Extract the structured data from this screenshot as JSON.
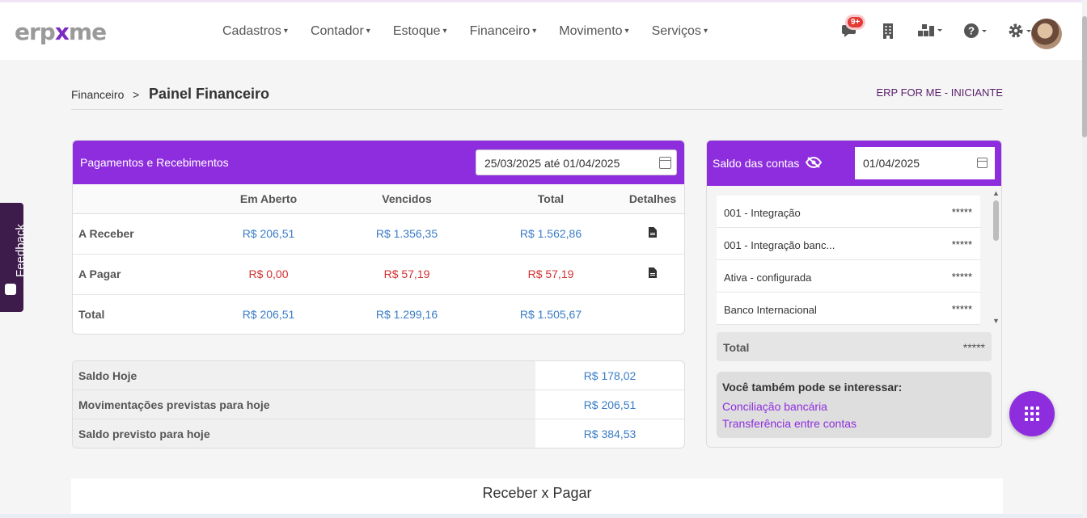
{
  "header": {
    "logo": {
      "left": "erp",
      "mid": "x",
      "right": "me"
    },
    "nav": [
      "Cadastros",
      "Contador",
      "Estoque",
      "Financeiro",
      "Movimento",
      "Serviços"
    ],
    "notification_badge": "9+"
  },
  "breadcrumb": {
    "parent": "Financeiro",
    "separator": ">",
    "current": "Painel Financeiro",
    "plan": "ERP FOR ME - INICIANTE"
  },
  "feedback_label": "Feedback",
  "payments": {
    "title": "Pagamentos e Recebimentos",
    "date_range": "25/03/2025 até 01/04/2025",
    "columns": [
      "",
      "Em Aberto",
      "Vencidos",
      "Total",
      "Detalhes"
    ],
    "rows": [
      {
        "label": "A Receber",
        "aberto": "R$ 206,51",
        "vencidos": "R$ 1.356,35",
        "total": "R$ 1.562,86"
      },
      {
        "label": "A Pagar",
        "aberto": "R$ 0,00",
        "vencidos": "R$ 57,19",
        "total": "R$ 57,19"
      },
      {
        "label": "Total",
        "aberto": "R$ 206,51",
        "vencidos": "R$ 1.299,16",
        "total": "R$ 1.505,67"
      }
    ]
  },
  "saldo_hoje": {
    "rows": [
      {
        "label": "Saldo Hoje",
        "value": "R$ 178,02"
      },
      {
        "label": "Movimentações previstas para hoje",
        "value": "R$ 206,51"
      },
      {
        "label": "Saldo previsto para hoje",
        "value": "R$ 384,53"
      }
    ]
  },
  "saldo_contas": {
    "title": "Saldo das contas",
    "date": "01/04/2025",
    "accounts": [
      {
        "name": "001 - Integração",
        "value": "*****"
      },
      {
        "name": "001 - Integração banc...",
        "value": "*****"
      },
      {
        "name": "Ativa - configurada",
        "value": "*****"
      },
      {
        "name": "Banco Internacional",
        "value": "*****"
      }
    ],
    "total_label": "Total",
    "total_value": "*****",
    "interest_title": "Você também pode se interessar:",
    "interest_links": [
      "Conciliação bancária",
      "Transferência entre contas"
    ]
  },
  "chart_section_title": "Receber x Pagar",
  "colors": {
    "accent": "#8e2dde",
    "blue": "#3a7cc5",
    "red": "#d32f2f"
  }
}
